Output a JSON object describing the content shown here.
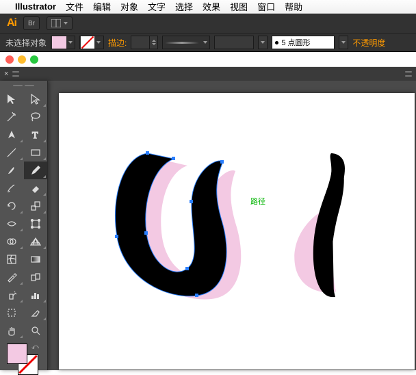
{
  "menubar": {
    "app": "Illustrator",
    "items": [
      "文件",
      "编辑",
      "对象",
      "文字",
      "选择",
      "效果",
      "视图",
      "窗口",
      "帮助"
    ]
  },
  "aibar": {
    "logo": "Ai",
    "br": "Br"
  },
  "optbar": {
    "selection": "未选择对象",
    "fill_color": "#f3c9e3",
    "stroke_label": "描边:",
    "brush_name": "5 点圆形",
    "opacity_label": "不透明度"
  },
  "canvas": {
    "path_label": "路径"
  }
}
